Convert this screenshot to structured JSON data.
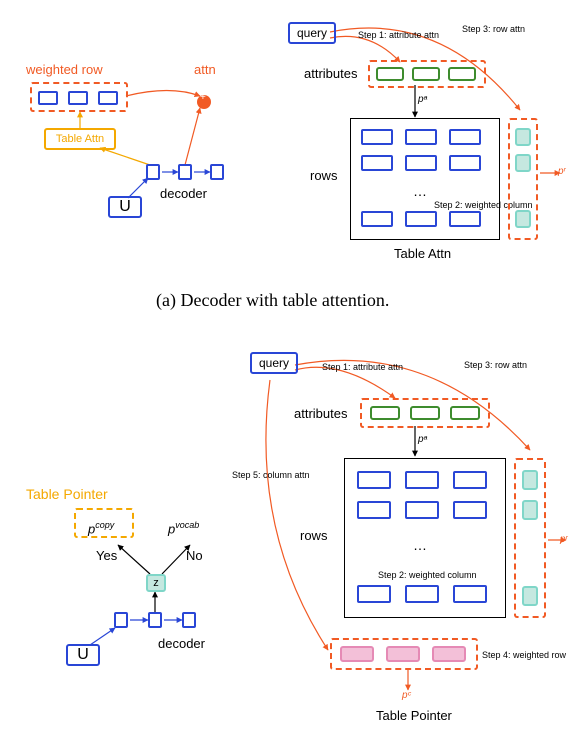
{
  "panel_a": {
    "query_label": "query",
    "attributes_label": "attributes",
    "rows_label": "rows",
    "table_attn_label": "Table Attn",
    "weighted_row_label": "weighted row",
    "attn_label": "attn",
    "table_attn_box": "Table Attn",
    "decoder_label": "decoder",
    "U_label": "U",
    "p_a": "pᵃ",
    "p_r": "pʳ",
    "step1": "Step 1: attribute attn",
    "step2": "Step 2: weighted column",
    "step3": "Step 3: row attn",
    "caption": "(a) Decoder with table attention.",
    "chart_data": {
      "type": "diagram",
      "title": "Decoder with table attention",
      "nodes": [
        "query",
        "attributes",
        "rows",
        "Table Attn",
        "weighted row",
        "attn",
        "U",
        "decoder"
      ],
      "outputs": [
        "p^a",
        "p^r"
      ],
      "steps": [
        "Step 1: attribute attn",
        "Step 2: weighted column",
        "Step 3: row attn"
      ],
      "attribute_cells": 3,
      "table_rows_shown": 2,
      "table_cols_shown": 3,
      "ellipsis": true
    }
  },
  "panel_b": {
    "query_label": "query",
    "attributes_label": "attributes",
    "rows_label": "rows",
    "table_pointer_heading": "Table Pointer",
    "table_pointer_label": "Table Pointer",
    "decoder_label": "decoder",
    "U_label": "U",
    "yes": "Yes",
    "no": "No",
    "z_label": "z",
    "p_copy": "p",
    "p_copy_sup": "copy",
    "p_vocab": "p",
    "p_vocab_sup": "vocab",
    "p_a": "pᵃ",
    "p_r": "pʳ",
    "p_c": "pᶜ",
    "step1": "Step 1: attribute attn",
    "step2": "Step 2: weighted column",
    "step3": "Step 3: row attn",
    "step4": "Step 4: weighted row",
    "step5": "Step 5: column attn",
    "chart_data": {
      "type": "diagram",
      "title": "Table Pointer",
      "nodes": [
        "query",
        "attributes",
        "rows",
        "Table Pointer",
        "U",
        "decoder",
        "z"
      ],
      "branches": {
        "Yes": "p^copy",
        "No": "p^vocab"
      },
      "outputs": [
        "p^a",
        "p^r",
        "p^c"
      ],
      "steps": [
        "Step 1: attribute attn",
        "Step 2: weighted column",
        "Step 3: row attn",
        "Step 4: weighted row",
        "Step 5: column attn"
      ],
      "attribute_cells": 3,
      "table_rows_shown": 2,
      "table_cols_shown": 3,
      "weighted_row_cells": 3,
      "ellipsis": true
    }
  }
}
